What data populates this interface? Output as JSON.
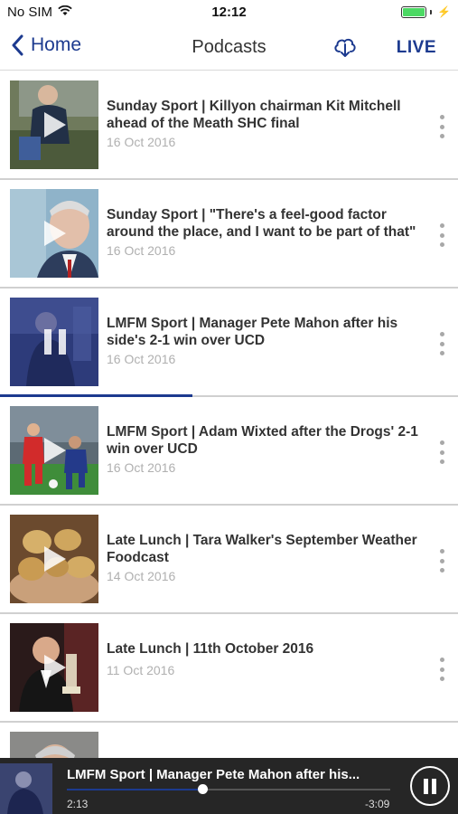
{
  "status_bar": {
    "carrier": "No SIM",
    "time": "12:12",
    "battery_color": "#4cd964"
  },
  "nav": {
    "back_label": "Home",
    "title": "Podcasts",
    "download_icon": "cloud-download-icon",
    "live_label": "LIVE",
    "accent_color": "#1c3a8f"
  },
  "podcasts": [
    {
      "title": "Sunday Sport | Killyon chairman Kit Mitchell ahead of the Meath SHC final",
      "date": "16 Oct 2016",
      "state": "play"
    },
    {
      "title": "Sunday Sport | \"There's a feel-good factor around the place, and I want to be part of that\"",
      "date": "16 Oct 2016",
      "state": "play"
    },
    {
      "title": "LMFM Sport | Manager Pete Mahon after his side's 2-1 win over UCD",
      "date": "16 Oct 2016",
      "state": "paused",
      "progress": 0.42
    },
    {
      "title": "LMFM Sport | Adam Wixted after the Drogs' 2-1 win over UCD",
      "date": "16 Oct 2016",
      "state": "play"
    },
    {
      "title": "Late Lunch | Tara Walker's September Weather Foodcast",
      "date": "14 Oct 2016",
      "state": "play"
    },
    {
      "title": "Late Lunch | 11th October 2016",
      "date": "11 Oct 2016",
      "state": "play"
    }
  ],
  "player": {
    "title": "LMFM Sport | Manager Pete Mahon after his...",
    "elapsed": "2:13",
    "remaining": "-3:09",
    "progress": 0.42
  }
}
